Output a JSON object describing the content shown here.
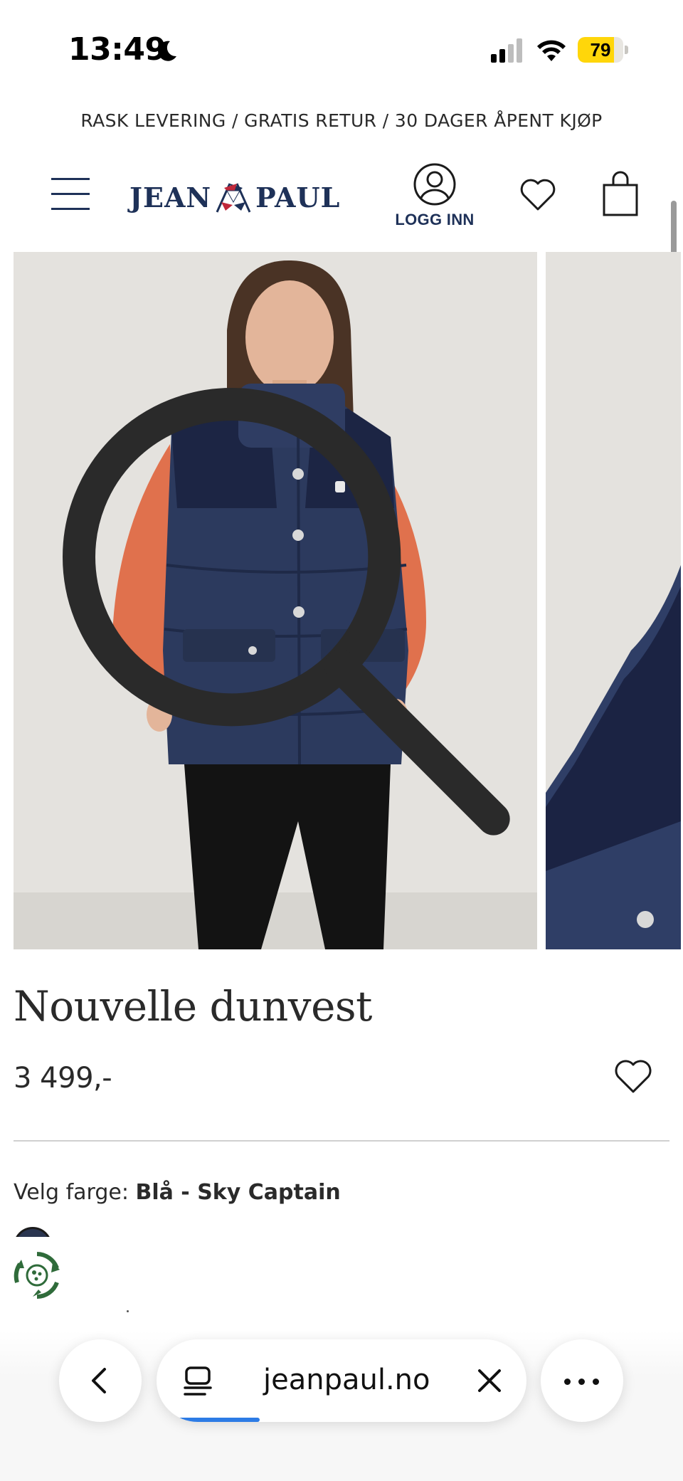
{
  "status_bar": {
    "time": "13:49",
    "battery_percent": "79",
    "battery_level": 0.79,
    "icons": [
      "moon-icon",
      "signal-icon",
      "wifi-icon",
      "battery-icon"
    ]
  },
  "promo_banner": {
    "text": "RASK LEVERING / GRATIS RETUR / 30 DAGER ÅPENT KJØP"
  },
  "header": {
    "logo_left": "JEAN",
    "logo_right": "PAUL",
    "login_label": "LOGG INN",
    "icons": [
      "menu-icon",
      "user-icon",
      "heart-icon",
      "shopping-bag-icon"
    ]
  },
  "gallery": {
    "images": [
      "main-product-image",
      "secondary-product-image"
    ],
    "zoom_icon": "search-icon"
  },
  "product": {
    "title": "Nouvelle dunvest",
    "price": "3 499,-",
    "color_label": "Velg farge: ",
    "color_value": "Blå - Sky Captain"
  },
  "browser": {
    "url": "jeanpaul.no",
    "load_progress": 0.25,
    "icons": [
      "chevron-left-icon",
      "reader-icon",
      "close-icon",
      "more-icon"
    ]
  },
  "colors": {
    "brand_navy": "#1e3158",
    "battery_yellow": "#ffd60a",
    "progress_blue": "#2c7be5",
    "eco_green": "#2f6b3a"
  }
}
